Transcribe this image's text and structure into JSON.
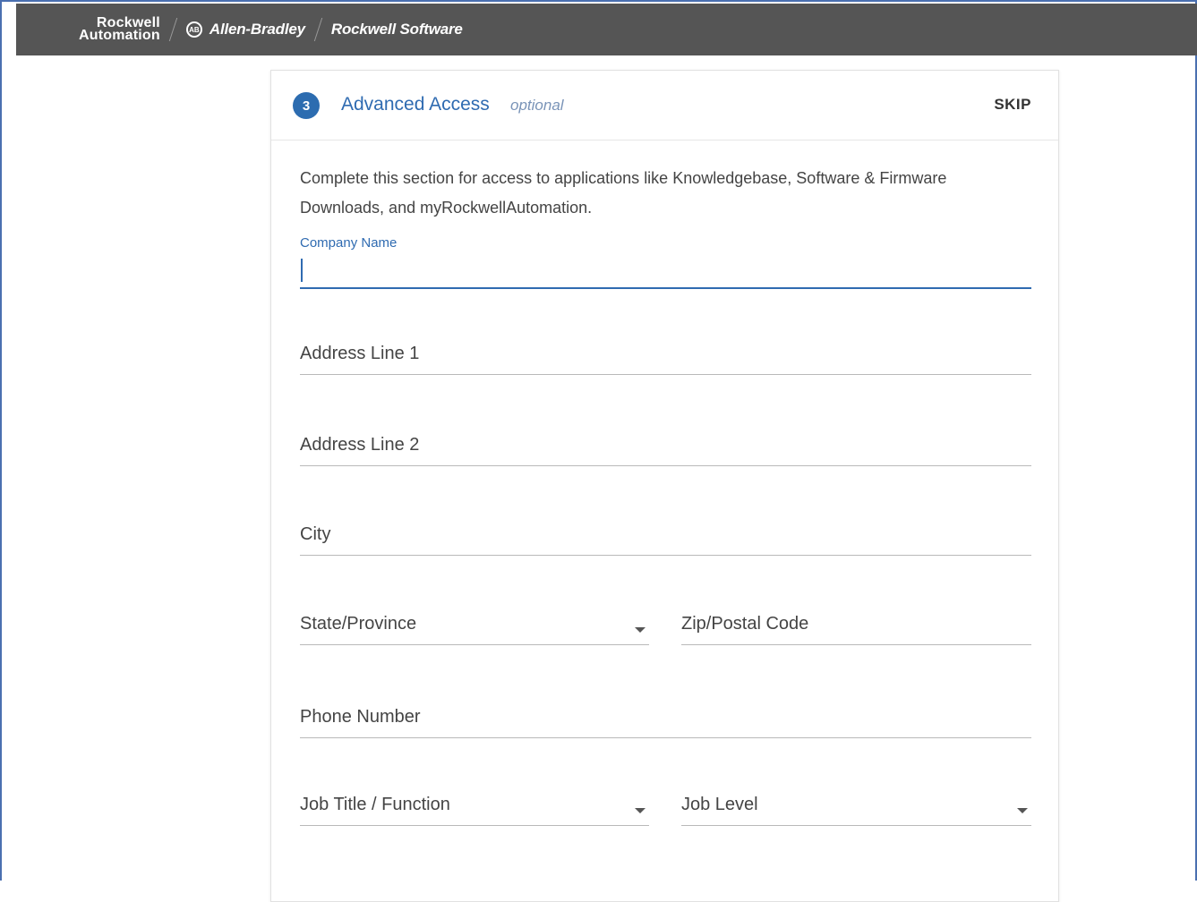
{
  "brand": {
    "ra_line1": "Rockwell",
    "ra_line2": "Automation",
    "ab_badge": "AB",
    "allen_bradley": "Allen-Bradley",
    "rockwell_software": "Rockwell Software"
  },
  "step": {
    "number": "3",
    "title": "Advanced Access",
    "optional": "optional",
    "skip_label": "SKIP"
  },
  "intro": "Complete this section for access to applications like Knowledgebase, Software & Firmware Downloads, and myRockwellAutomation.",
  "fields": {
    "company_name": {
      "label": "Company Name",
      "value": ""
    },
    "address1": {
      "placeholder": "Address Line 1"
    },
    "address2": {
      "placeholder": "Address Line 2"
    },
    "city": {
      "placeholder": "City"
    },
    "state": {
      "placeholder": "State/Province"
    },
    "zip": {
      "placeholder": "Zip/Postal Code"
    },
    "phone": {
      "placeholder": "Phone Number"
    },
    "job_title": {
      "placeholder": "Job Title / Function"
    },
    "job_level": {
      "placeholder": "Job Level"
    }
  },
  "colors": {
    "accent": "#2f6bb1",
    "brandbar": "#555555"
  }
}
